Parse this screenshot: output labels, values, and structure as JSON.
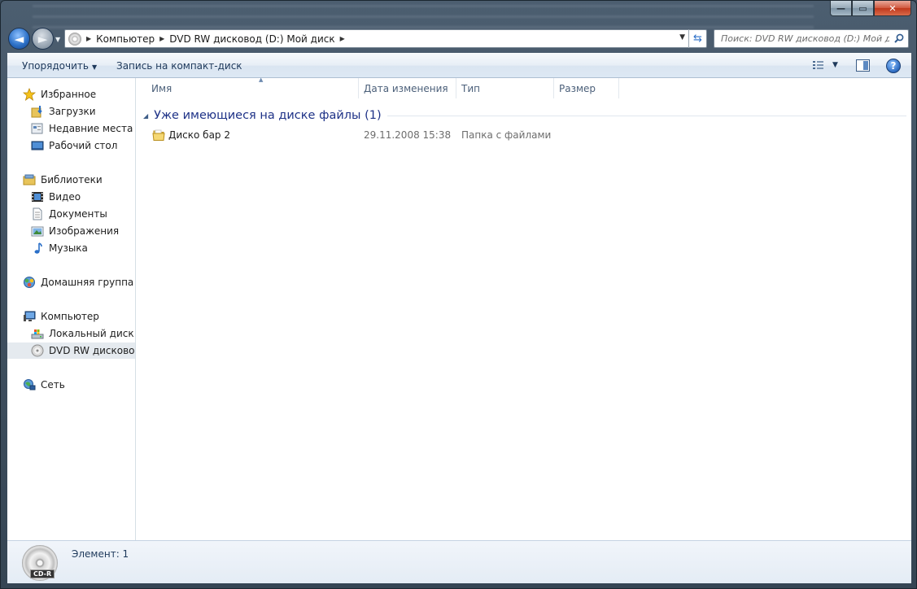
{
  "window": {
    "caption_min": "—",
    "caption_max": "▭",
    "caption_close": "✕"
  },
  "nav": {
    "back_glyph": "◄",
    "forward_glyph": "►",
    "breadcrumb": [
      "Компьютер",
      "DVD RW дисковод (D:) Мой диск"
    ],
    "search_placeholder": "Поиск: DVD RW дисковод (D:) Мой д..."
  },
  "toolbar": {
    "organize_label": "Упорядочить",
    "burn_label": "Запись на компакт-диск",
    "help_label": "?"
  },
  "sidebar": {
    "favorites": {
      "label": "Избранное",
      "items": [
        "Загрузки",
        "Недавние места",
        "Рабочий стол"
      ]
    },
    "libraries": {
      "label": "Библиотеки",
      "items": [
        "Видео",
        "Документы",
        "Изображения",
        "Музыка"
      ]
    },
    "homegroup": {
      "label": "Домашняя группа"
    },
    "computer": {
      "label": "Компьютер",
      "items": [
        "Локальный диск (C",
        "DVD RW дисковод ("
      ],
      "selected_index": 1
    },
    "network": {
      "label": "Сеть"
    }
  },
  "columns": [
    "Имя",
    "Дата изменения",
    "Тип",
    "Размер"
  ],
  "group": {
    "title": "Уже имеющиеся на диске файлы (1)"
  },
  "files": [
    {
      "name": "Диско бар 2",
      "modified": "29.11.2008 15:38",
      "type": "Папка с файлами",
      "size": "",
      "icon": "folder-icon"
    }
  ],
  "status": {
    "item_count": "Элемент: 1",
    "disc_label": "CD-R"
  },
  "colors": {
    "accent": "#1e3287",
    "toolbar_text": "#1e395b",
    "selected_bg": "#e5eaef"
  }
}
